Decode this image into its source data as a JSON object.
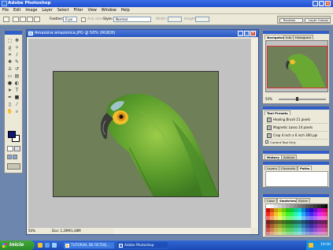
{
  "app": {
    "title": "Adobe Photoshop"
  },
  "menu": [
    "File",
    "Edit",
    "Image",
    "Layer",
    "Select",
    "Filter",
    "View",
    "Window",
    "Help"
  ],
  "options": {
    "feather_label": "Feather:",
    "feather_value": "0 px",
    "antialias_label": "Anti-alias",
    "style_label": "Style:",
    "style_value": "Normal",
    "width_label": "Width:",
    "height_label": "Height:"
  },
  "palette_well": {
    "tabs": [
      "Brushes",
      "Layer Comps"
    ]
  },
  "document": {
    "title": "Amazona amazonica.JPG @ 50% (RGB/8)",
    "zoom": "50%",
    "doc_info": "Doc: 1,29M/1,48M"
  },
  "navigator": {
    "tabs": [
      "Navigator",
      "Info",
      "Histogram"
    ],
    "zoom": "50%"
  },
  "tool_presets": {
    "tab": "Tool Presets",
    "items": [
      "Healing Brush 21 pixels",
      "Magnetic Lasso 24 pixels",
      "Crop 4 inch x 6 inch 300 ppi"
    ],
    "current_tool_only": "Current Tool Only"
  },
  "history": {
    "tabs": [
      "History",
      "Actions"
    ]
  },
  "layers": {
    "tabs": [
      "Layers",
      "Channels",
      "Paths"
    ]
  },
  "swatches": {
    "tabs": [
      "Color",
      "Swatches",
      "Styles"
    ]
  },
  "taskbar": {
    "start_label": "Inicio",
    "tasks": [
      "TUTORIAL DE RETOQ...",
      "Adobe Photoshop"
    ],
    "clock": "19:00"
  },
  "colors": {
    "accent": "#2e5ec9",
    "foreground": "#0e1775",
    "background": "#ffffff",
    "image_bg": "#6f7f58"
  },
  "icons": [
    "marquee-icon",
    "move-icon",
    "lasso-icon",
    "magic-wand-icon",
    "crop-icon",
    "slice-icon",
    "healing-icon",
    "brush-icon",
    "stamp-icon",
    "history-brush-icon",
    "eraser-icon",
    "gradient-icon",
    "blur-icon",
    "dodge-icon",
    "path-select-icon",
    "type-icon",
    "pen-icon",
    "shape-icon",
    "notes-icon",
    "eyedropper-icon",
    "hand-icon",
    "zoom-icon"
  ]
}
